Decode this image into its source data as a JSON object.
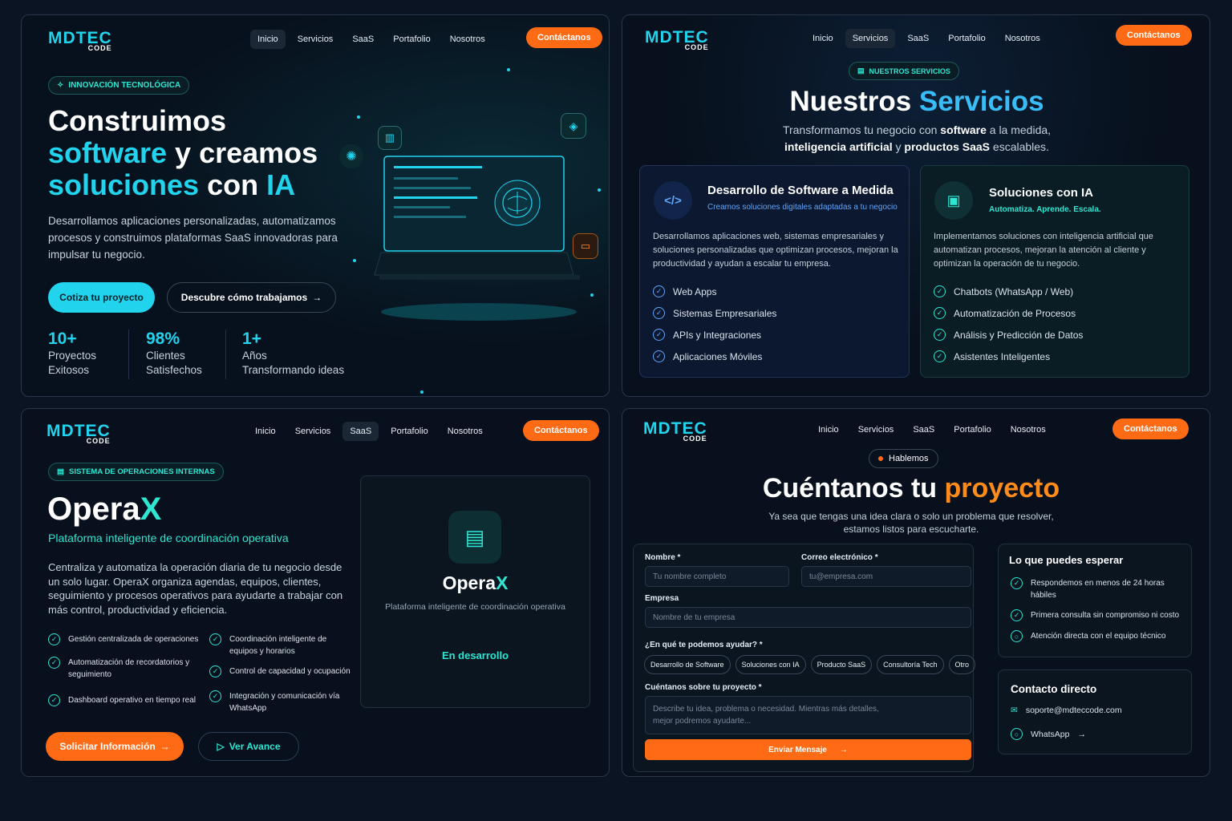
{
  "brand": {
    "logo_main": "MDTEC",
    "logo_sub": "CODE"
  },
  "nav": {
    "inicio": "Inicio",
    "servicios": "Servicios",
    "saas": "SaaS",
    "portafolio": "Portafolio",
    "nosotros": "Nosotros",
    "contact": "Contáctanos"
  },
  "hero": {
    "badge": "INNOVACIÓN TECNOLÓGICA",
    "title_l1": "Construimos",
    "title_l2a": "software",
    "title_l2b": " y creamos",
    "title_l3a": "soluciones",
    "title_l3b": " con ",
    "title_l3c": "IA",
    "desc": "Desarrollamos aplicaciones personalizadas, automatizamos procesos y construimos plataformas SaaS innovadoras para impulsar tu negocio.",
    "cta_primary": "Cotiza tu proyecto",
    "cta_secondary": "Descubre cómo trabajamos",
    "stats": [
      {
        "n": "10+",
        "l1": "Proyectos",
        "l2": "Exitosos"
      },
      {
        "n": "98%",
        "l1": "Clientes",
        "l2": "Satisfechos"
      },
      {
        "n": "1+",
        "l1": "Años",
        "l2": "Transformando ideas"
      }
    ]
  },
  "services": {
    "badge": "NUESTROS SERVICIOS",
    "title_a": "Nuestros ",
    "title_b": "Servicios",
    "sub_l1a": "Transformamos tu negocio con ",
    "sub_l1b": "software",
    "sub_l1c": " a la medida,",
    "sub_l2a": "inteligencia artificial",
    "sub_l2b": " y ",
    "sub_l2c": "productos SaaS",
    "sub_l2d": " escalables.",
    "cards": [
      {
        "title": "Desarrollo de Software a Medida",
        "sub": "Creamos soluciones digitales adaptadas a tu negocio",
        "desc": "Desarrollamos aplicaciones web, sistemas empresariales y soluciones personalizadas que optimizan procesos, mejoran la productividad y ayudan a escalar tu empresa.",
        "items": [
          "Web Apps",
          "Sistemas Empresariales",
          "APIs y Integraciones",
          "Aplicaciones Móviles"
        ]
      },
      {
        "title": "Soluciones con IA",
        "sub": "Automatiza. Aprende. Escala.",
        "desc": "Implementamos soluciones con inteligencia artificial que automatizan procesos, mejoran la atención al cliente y optimizan la operación de tu negocio.",
        "items": [
          "Chatbots (WhatsApp / Web)",
          "Automatización de Procesos",
          "Análisis y Predicción de Datos",
          "Asistentes Inteligentes"
        ]
      }
    ]
  },
  "saas": {
    "badge": "SISTEMA DE OPERACIONES INTERNAS",
    "title_a": "Opera",
    "title_b": "X",
    "subtitle": "Plataforma inteligente de coordinación operativa",
    "desc": "Centraliza y automatiza la operación diaria de tu negocio desde un solo lugar. OperaX organiza agendas, equipos, clientes, seguimiento y procesos operativos para ayudarte a trabajar con más control, productividad y eficiencia.",
    "features_left": [
      "Gestión centralizada de operaciones",
      "Automatización de recordatorios y seguimiento",
      "Dashboard operativo en tiempo real"
    ],
    "features_right": [
      "Coordinación inteligente de equipos y horarios",
      "Control de capacidad y ocupación",
      "Integración y comunicación vía WhatsApp"
    ],
    "cta_primary": "Solicitar Información",
    "cta_secondary": "Ver Avance",
    "card_title_a": "Opera",
    "card_title_b": "X",
    "card_sub": "Plataforma inteligente de coordinación operativa",
    "card_status": "En desarrollo"
  },
  "contact": {
    "badge": "Hablemos",
    "title_a": "Cuéntanos tu ",
    "title_b": "proyecto",
    "sub_l1": "Ya sea que tengas una idea clara o solo un problema que resolver,",
    "sub_l2": "estamos listos para escucharte.",
    "form": {
      "name_label": "Nombre *",
      "name_ph": "Tu nombre completo",
      "email_label": "Correo electrónico *",
      "email_ph": "tu@empresa.com",
      "company_label": "Empresa",
      "company_ph": "Nombre de tu empresa",
      "help_label": "¿En qué te podemos ayudar? *",
      "options": [
        "Desarrollo de Software",
        "Soluciones con IA",
        "Producto SaaS",
        "Consultoría Tech",
        "Otro"
      ],
      "project_label": "Cuéntanos sobre tu proyecto *",
      "project_ph_l1": "Describe tu idea, problema o necesidad. Mientras más detalles,",
      "project_ph_l2": "mejor podremos ayudarte...",
      "submit": "Enviar Mensaje"
    },
    "expect": {
      "title": "Lo que puedes esperar",
      "items": [
        "Respondemos en menos de 24 horas hábiles",
        "Primera consulta sin compromiso ni costo",
        "Atención directa con el equipo técnico"
      ]
    },
    "direct": {
      "title": "Contacto directo",
      "email": "soporte@mdteccode.com",
      "whatsapp": "WhatsApp"
    }
  },
  "colors": {
    "accent": "#22d3ee",
    "orange": "#ff6a14",
    "bg": "#07101c"
  }
}
